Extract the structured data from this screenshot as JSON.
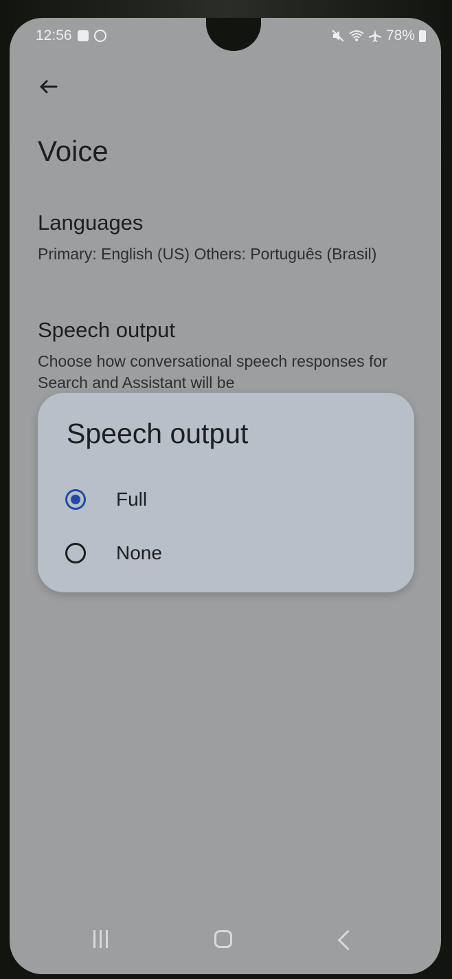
{
  "status_bar": {
    "time": "12:56",
    "battery": "78%"
  },
  "page": {
    "title": "Voice"
  },
  "sections": {
    "languages": {
      "title": "Languages",
      "subtitle": "Primary: English (US) Others: Português (Brasil)"
    },
    "speech_output": {
      "title": "Speech output",
      "subtitle": "Choose how conversational speech responses for Search and Assistant will be"
    }
  },
  "dialog": {
    "title": "Speech output",
    "options": [
      {
        "label": "Full",
        "selected": true
      },
      {
        "label": "None",
        "selected": false
      }
    ]
  },
  "colors": {
    "accent": "#1f4aa8",
    "dialog_bg": "#b7c0c8",
    "scrim_bg": "#9c9ea0"
  }
}
